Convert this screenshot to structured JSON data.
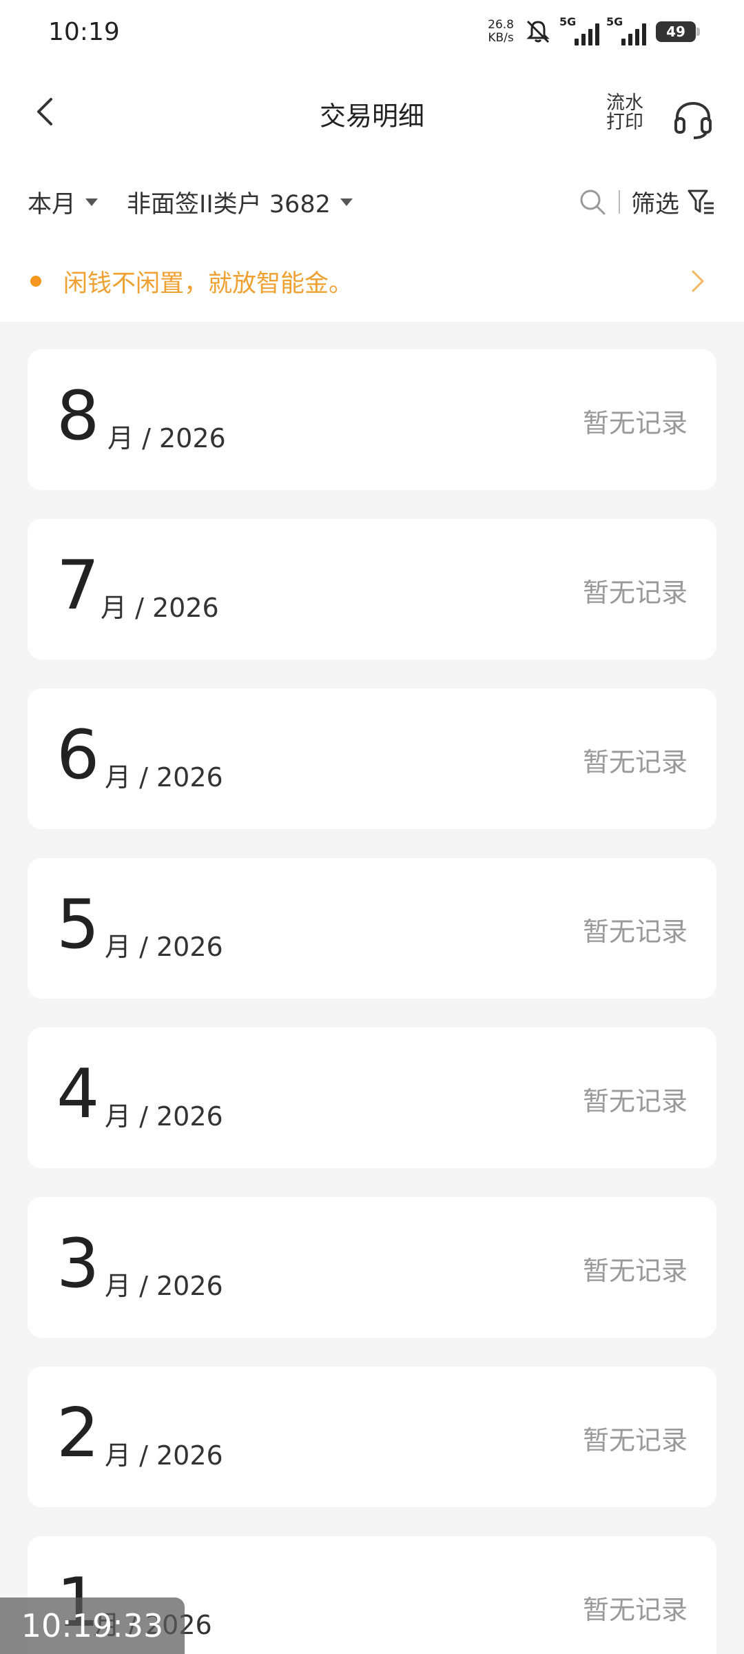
{
  "status_bar": {
    "time": "10:19",
    "speed_value": "26.8",
    "speed_unit": "KB/s",
    "net1": "5G",
    "net2": "5G",
    "battery": "49"
  },
  "nav": {
    "title": "交易明细",
    "print_line1": "流水",
    "print_line2": "打印"
  },
  "filters": {
    "period": "本月",
    "account": "非面签II类户 3682",
    "filter_label": "筛选"
  },
  "notice": {
    "text": "闲钱不闲置，就放智能金。"
  },
  "months": [
    {
      "month": "8",
      "unit": "月 / 2026",
      "status": "暂无记录"
    },
    {
      "month": "7",
      "unit": "月 / 2026",
      "status": "暂无记录"
    },
    {
      "month": "6",
      "unit": "月 / 2026",
      "status": "暂无记录"
    },
    {
      "month": "5",
      "unit": "月 / 2026",
      "status": "暂无记录"
    },
    {
      "month": "4",
      "unit": "月 / 2026",
      "status": "暂无记录"
    },
    {
      "month": "3",
      "unit": "月 / 2026",
      "status": "暂无记录"
    },
    {
      "month": "2",
      "unit": "月 / 2026",
      "status": "暂无记录"
    },
    {
      "month": "1",
      "unit": "月 / 2026",
      "status": "暂无记录"
    }
  ],
  "overlay": {
    "timestamp": "10:19:33"
  },
  "colors": {
    "accent": "#f5961e",
    "background": "#f5f5f5"
  }
}
